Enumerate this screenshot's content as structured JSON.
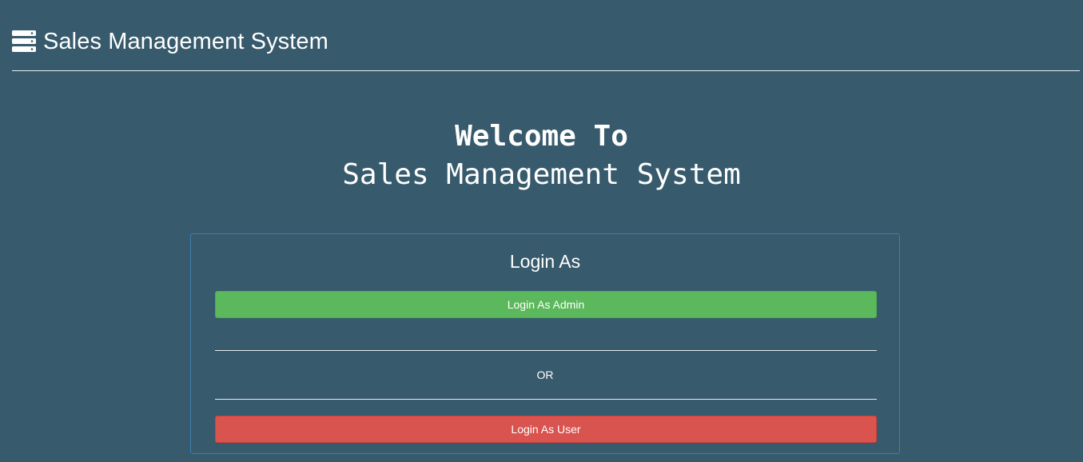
{
  "header": {
    "icon": "server-icon",
    "title": "Sales Management System"
  },
  "welcome": {
    "line1": "Welcome To",
    "line2": "Sales Management System"
  },
  "login_panel": {
    "title": "Login As",
    "admin_button_label": "Login As Admin",
    "separator_text": "OR",
    "user_button_label": "Login As User"
  },
  "colors": {
    "background": "#375a6c",
    "admin_button": "#5cb85c",
    "user_button": "#d9534f",
    "panel_border": "#3f7fae"
  }
}
